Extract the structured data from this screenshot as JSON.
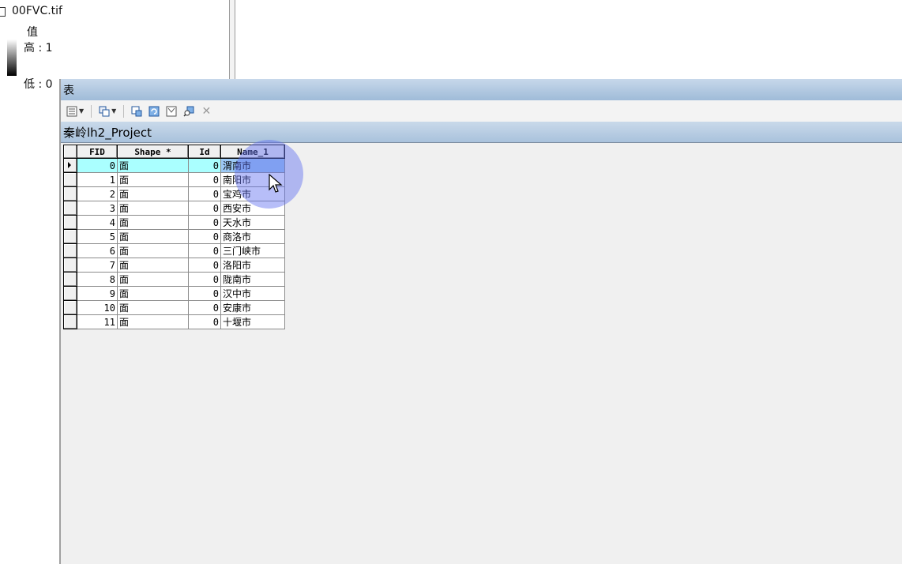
{
  "toc": {
    "layer_name": "00FVC.tif",
    "legend_title": "值",
    "high_label": "高 : 1",
    "low_label": "低 : 0"
  },
  "table_window": {
    "title": "表",
    "tab_name": "秦岭lh2_Project",
    "toolbar_icons": [
      "table-options-icon",
      "related-tables-icon",
      "select-by-attributes-icon",
      "switch-selection-icon",
      "clear-selection-icon",
      "zoom-to-selected-icon",
      "delete-selected-icon"
    ]
  },
  "grid": {
    "columns": [
      "FID",
      "Shape *",
      "Id",
      "Name_1"
    ],
    "rows": [
      [
        "0",
        "面",
        "0",
        "渭南市"
      ],
      [
        "1",
        "面",
        "0",
        "南阳市"
      ],
      [
        "2",
        "面",
        "0",
        "宝鸡市"
      ],
      [
        "3",
        "面",
        "0",
        "西安市"
      ],
      [
        "4",
        "面",
        "0",
        "天水市"
      ],
      [
        "5",
        "面",
        "0",
        "商洛市"
      ],
      [
        "6",
        "面",
        "0",
        "三门峡市"
      ],
      [
        "7",
        "面",
        "0",
        "洛阳市"
      ],
      [
        "8",
        "面",
        "0",
        "陇南市"
      ],
      [
        "9",
        "面",
        "0",
        "汉中市"
      ],
      [
        "10",
        "面",
        "0",
        "安康市"
      ],
      [
        "11",
        "面",
        "0",
        "十堰市"
      ]
    ],
    "active_row": 0
  },
  "colors": {
    "title_bar": "#9fbbd8",
    "active_row": "#aaffff",
    "active_cell": "#9cc9f5",
    "cursor_halo": "#5f6ef0"
  }
}
